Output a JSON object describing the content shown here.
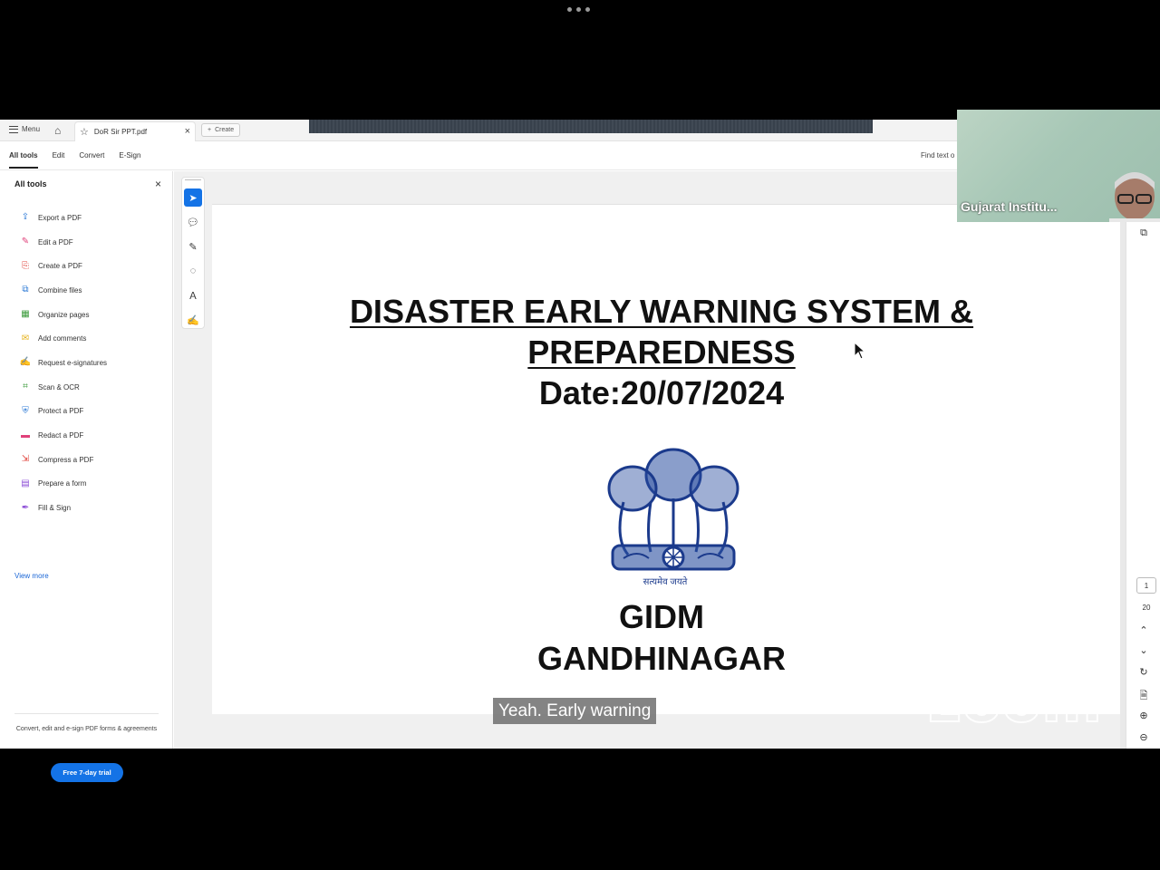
{
  "tabbar": {
    "menu_label": "Menu",
    "doc_tab_label": "DoR Sir PPT.pdf",
    "create_label": "Create"
  },
  "subbar": {
    "tabs": [
      "All tools",
      "Edit",
      "Convert",
      "E-Sign"
    ],
    "find_text": "Find text o"
  },
  "sidebar": {
    "title": "All tools",
    "tools": [
      {
        "label": "Export a PDF",
        "icon": "export-pdf-icon",
        "color": "#2d7ad6"
      },
      {
        "label": "Edit a PDF",
        "icon": "edit-pdf-icon",
        "color": "#e0417a"
      },
      {
        "label": "Create a PDF",
        "icon": "create-pdf-icon",
        "color": "#e0413a"
      },
      {
        "label": "Combine files",
        "icon": "combine-files-icon",
        "color": "#2d7ad6"
      },
      {
        "label": "Organize pages",
        "icon": "organize-pages-icon",
        "color": "#3a9a3a"
      },
      {
        "label": "Add comments",
        "icon": "add-comments-icon",
        "color": "#e6b21a"
      },
      {
        "label": "Request e-signatures",
        "icon": "request-esign-icon",
        "color": "#8b4bd6"
      },
      {
        "label": "Scan & OCR",
        "icon": "scan-ocr-icon",
        "color": "#3a9a3a"
      },
      {
        "label": "Protect a PDF",
        "icon": "protect-pdf-icon",
        "color": "#2d7ad6"
      },
      {
        "label": "Redact a PDF",
        "icon": "redact-pdf-icon",
        "color": "#e0417a"
      },
      {
        "label": "Compress a PDF",
        "icon": "compress-pdf-icon",
        "color": "#e0413a"
      },
      {
        "label": "Prepare a form",
        "icon": "prepare-form-icon",
        "color": "#8b4bd6"
      },
      {
        "label": "Fill & Sign",
        "icon": "fill-sign-icon",
        "color": "#8b4bd6"
      }
    ],
    "view_more": "View more",
    "promo_text": "Convert, edit and e-sign PDF forms & agreements",
    "trial_button": "Free 7-day trial"
  },
  "slide": {
    "title_line1": "DISASTER EARLY WARNING SYSTEM &",
    "title_line2": "PREPAREDNESS",
    "date": "Date:20/07/2024",
    "motto": "सत्यमेव जयते",
    "org_line1": "GIDM",
    "org_line2": "GANDHINAGAR"
  },
  "pager": {
    "current_page": "1",
    "total_pages": "20"
  },
  "caption": "Yeah. Early warning",
  "watermark": "zoom",
  "video": {
    "participant_name": "Gujarat Institu..."
  },
  "colors": {
    "accent": "#1473e6",
    "emblem": "#1b3a8c"
  }
}
